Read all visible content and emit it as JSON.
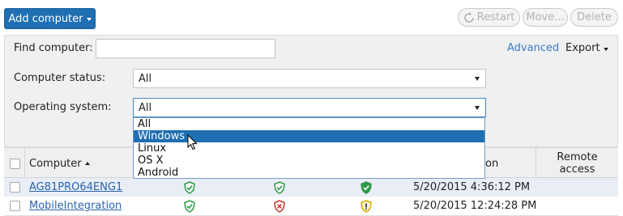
{
  "toolbar": {
    "add_computer": "Add computer",
    "restart": "Restart",
    "move": "Move...",
    "delete": "Delete"
  },
  "filters": {
    "find_label": "Find computer:",
    "find_value": "",
    "status_label": "Computer status:",
    "status_value": "All",
    "os_label": "Operating system:",
    "os_value": "All",
    "advanced": "Advanced",
    "export": "Export"
  },
  "os_dropdown": {
    "options": [
      "All",
      "Windows",
      "Linux",
      "OS X",
      "Android"
    ],
    "highlighted": "Windows"
  },
  "table": {
    "columns": {
      "computer": "Computer",
      "last_connection_fragment": "on",
      "remote_access_line1": "Remote",
      "remote_access_line2": "access"
    },
    "rows": [
      {
        "name": "AG81PRO64ENG1",
        "status1": "ok",
        "status2": "ok",
        "status3": "ok",
        "date": "5/20/2015 4:36:12 PM"
      },
      {
        "name": "MobileIntegration",
        "status1": "ok",
        "status2": "error",
        "status3": "warning",
        "date": "5/20/2015 12:24:28 PM"
      }
    ]
  },
  "colors": {
    "primary": "#1f6fb2",
    "ok": "#2e9a48",
    "error": "#c0392b",
    "warning": "#e0a800",
    "link": "#2a64ad"
  }
}
